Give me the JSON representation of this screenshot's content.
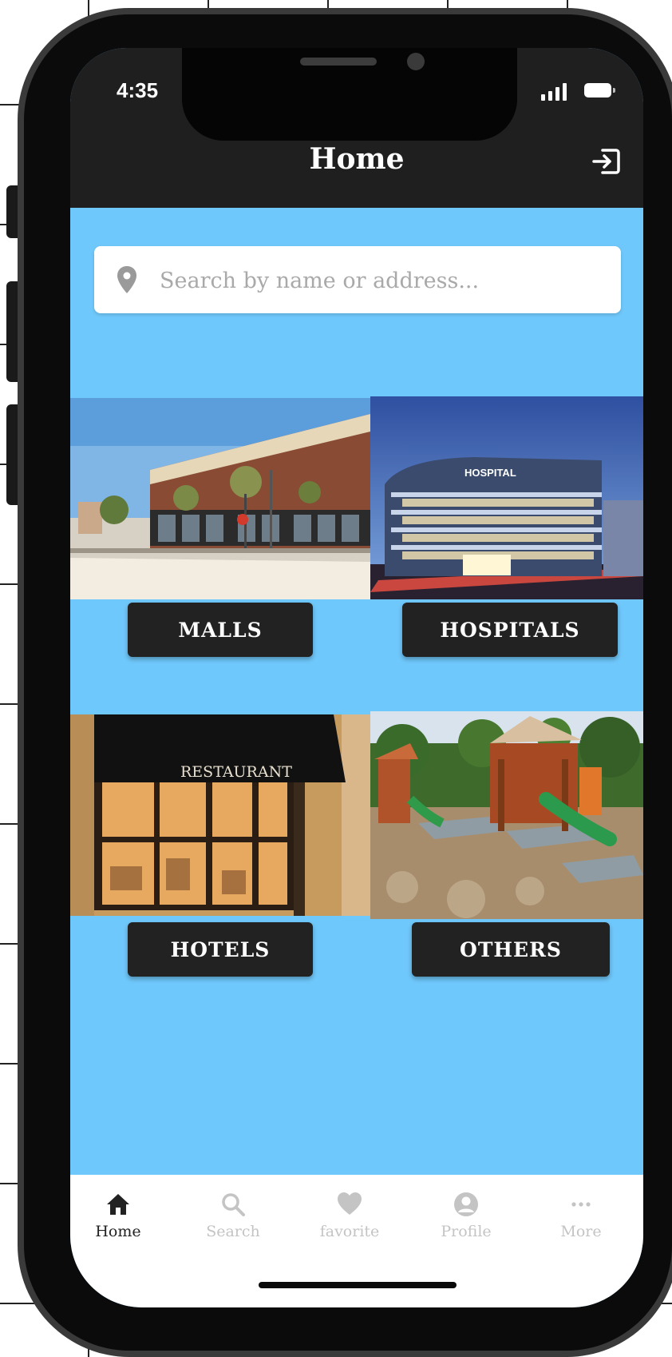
{
  "status_bar": {
    "time": "4:35"
  },
  "header": {
    "title": "Home",
    "logout_icon": "logout-icon"
  },
  "search": {
    "placeholder": "Search by name or address...",
    "value": "",
    "icon": "location-pin-icon"
  },
  "categories": [
    {
      "label": "MALLS",
      "image": "mall-building-photo"
    },
    {
      "label": "HOSPITALS",
      "image": "hospital-building-photo"
    },
    {
      "label": "HOTELS",
      "image": "restaurant-storefront-photo"
    },
    {
      "label": "OTHERS",
      "image": "playground-photo"
    }
  ],
  "bottom_nav": [
    {
      "label": "Home",
      "icon": "home-icon",
      "active": true
    },
    {
      "label": "Search",
      "icon": "search-icon",
      "active": false
    },
    {
      "label": "favorite",
      "icon": "heart-icon",
      "active": false
    },
    {
      "label": "Profile",
      "icon": "profile-icon",
      "active": false
    },
    {
      "label": "More",
      "icon": "more-icon",
      "active": false
    }
  ],
  "colors": {
    "screen_background": "#6fc8fb",
    "header_background": "#1f1f1f",
    "button_background": "#222222",
    "nav_active": "#222222",
    "nav_inactive": "#c4c4c4"
  }
}
